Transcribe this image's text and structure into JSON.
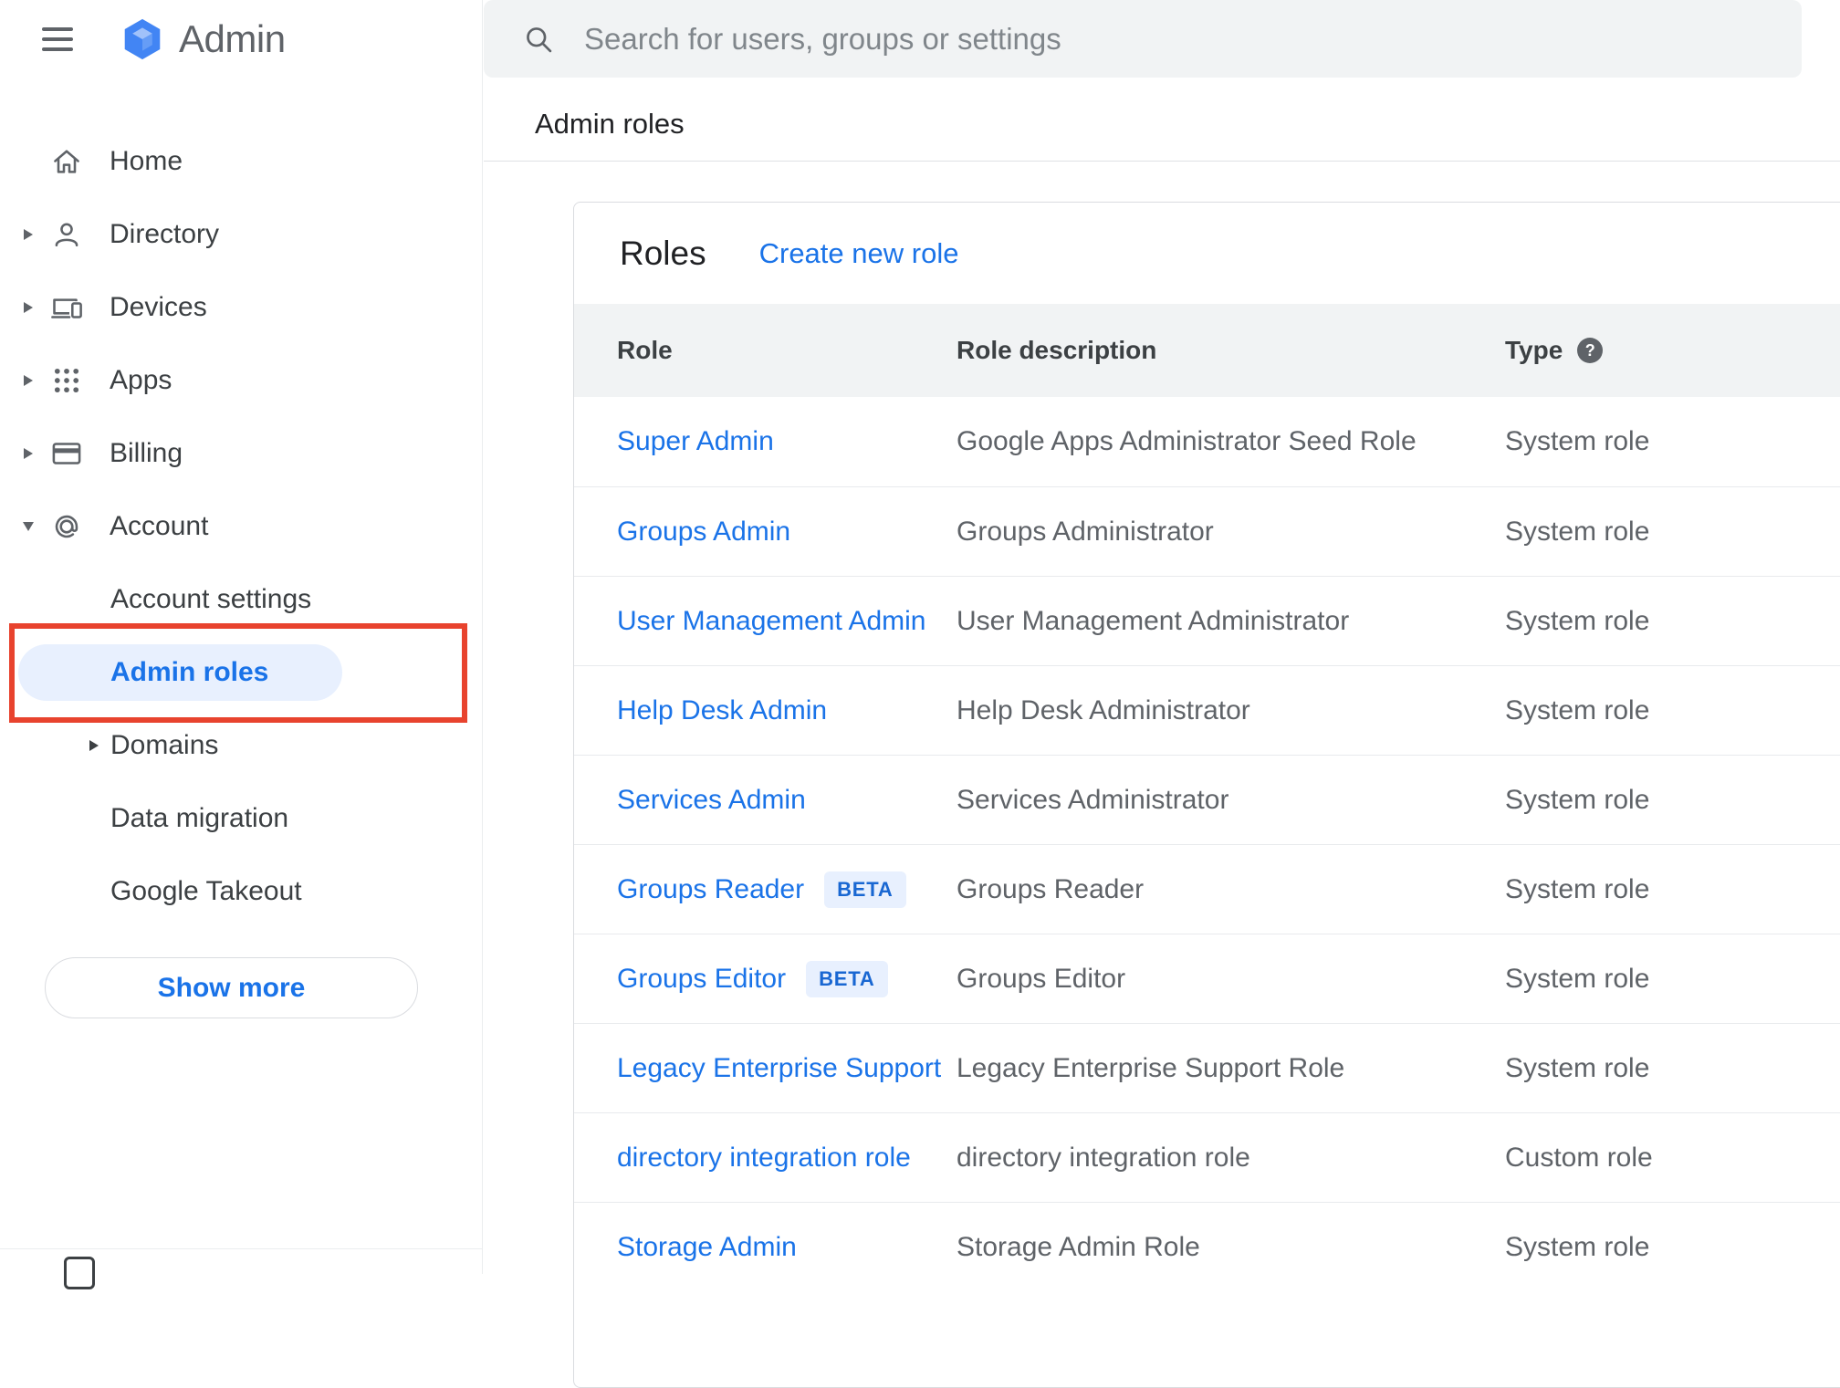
{
  "colors": {
    "accent_blue": "#1a73e8",
    "active_item_bg": "#e8f0fe",
    "annotation_red": "#e8432e",
    "beta_badge_bg": "#e8f0fe",
    "beta_badge_text": "#1967d2",
    "searchbar_bg": "#f1f3f4"
  },
  "sidebar": {
    "brand": "Admin",
    "items": [
      {
        "label": "Home",
        "icon": "home-icon",
        "chevron": "none"
      },
      {
        "label": "Directory",
        "icon": "person-icon",
        "chevron": "right"
      },
      {
        "label": "Devices",
        "icon": "devices-icon",
        "chevron": "right"
      },
      {
        "label": "Apps",
        "icon": "apps-icon",
        "chevron": "right"
      },
      {
        "label": "Billing",
        "icon": "billing-icon",
        "chevron": "right"
      },
      {
        "label": "Account",
        "icon": "at-icon",
        "chevron": "down"
      }
    ],
    "account_subitems": [
      {
        "label": "Account settings",
        "chevron": "none",
        "active": false,
        "annotated": false
      },
      {
        "label": "Admin roles",
        "chevron": "none",
        "active": true,
        "annotated": true
      },
      {
        "label": "Domains",
        "chevron": "right",
        "active": false,
        "annotated": false
      },
      {
        "label": "Data migration",
        "chevron": "none",
        "active": false,
        "annotated": false
      },
      {
        "label": "Google Takeout",
        "chevron": "none",
        "active": false,
        "annotated": false
      }
    ],
    "show_more": "Show more"
  },
  "topbar": {
    "search_placeholder": "Search for users, groups or settings"
  },
  "page": {
    "breadcrumb": "Admin roles"
  },
  "roles": {
    "title": "Roles",
    "create_new": "Create new role",
    "beta_label": "BETA",
    "columns": {
      "role": "Role",
      "description": "Role description",
      "type": "Type"
    },
    "rows": [
      {
        "role": "Super Admin",
        "beta": false,
        "description": "Google Apps Administrator Seed Role",
        "type": "System role"
      },
      {
        "role": "Groups Admin",
        "beta": false,
        "description": "Groups Administrator",
        "type": "System role"
      },
      {
        "role": "User Management Admin",
        "beta": false,
        "description": "User Management Administrator",
        "type": "System role"
      },
      {
        "role": "Help Desk Admin",
        "beta": false,
        "description": "Help Desk Administrator",
        "type": "System role"
      },
      {
        "role": "Services Admin",
        "beta": false,
        "description": "Services Administrator",
        "type": "System role"
      },
      {
        "role": "Groups Reader",
        "beta": true,
        "description": "Groups Reader",
        "type": "System role"
      },
      {
        "role": "Groups Editor",
        "beta": true,
        "description": "Groups Editor",
        "type": "System role"
      },
      {
        "role": "Legacy Enterprise Support",
        "beta": false,
        "description": "Legacy Enterprise Support Role",
        "type": "System role"
      },
      {
        "role": "directory integration role",
        "beta": false,
        "description": "directory integration role",
        "type": "Custom role"
      },
      {
        "role": "Storage Admin",
        "beta": false,
        "description": "Storage Admin Role",
        "type": "System role"
      }
    ]
  }
}
